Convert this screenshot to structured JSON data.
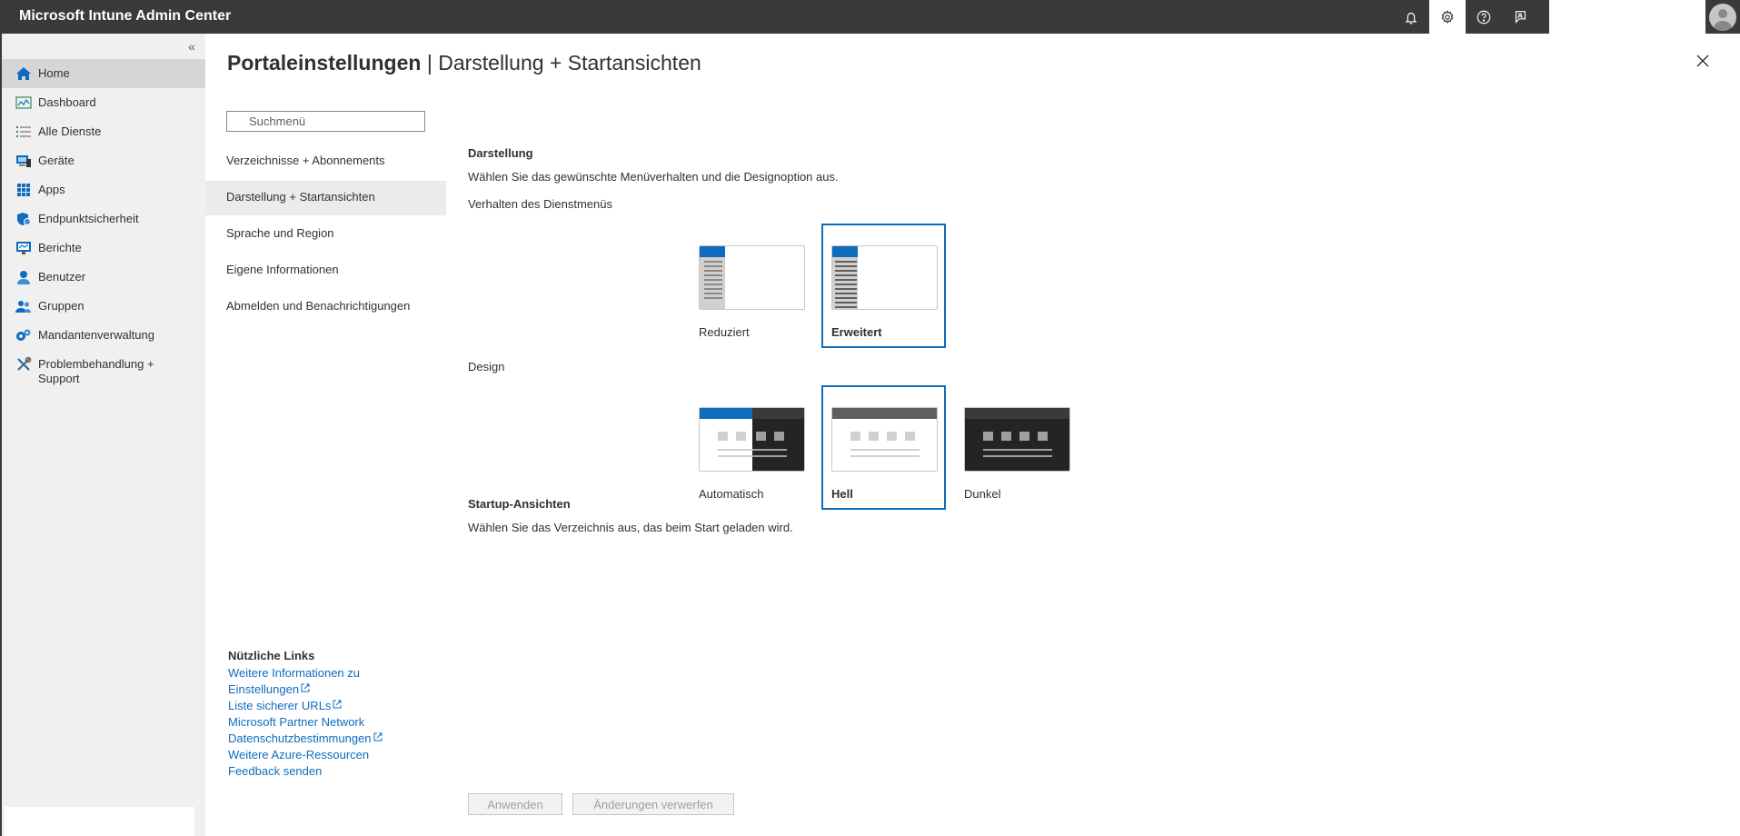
{
  "app": {
    "title": "Microsoft Intune Admin Center"
  },
  "topbar": {
    "icons": [
      "bell-icon",
      "gear-icon",
      "help-icon",
      "feedback-icon"
    ],
    "active_icon": "gear-icon"
  },
  "leftnav": {
    "collapse_glyph": "«",
    "items": [
      {
        "label": "Home",
        "icon": "home-icon",
        "selected": true
      },
      {
        "label": "Dashboard",
        "icon": "dashboard-icon"
      },
      {
        "label": "Alle Dienste",
        "icon": "list-icon"
      },
      {
        "label": "Geräte",
        "icon": "devices-icon"
      },
      {
        "label": "Apps",
        "icon": "apps-grid-icon"
      },
      {
        "label": "Endpunktsicherheit",
        "icon": "shield-icon"
      },
      {
        "label": "Berichte",
        "icon": "reports-icon"
      },
      {
        "label": "Benutzer",
        "icon": "user-icon"
      },
      {
        "label": "Gruppen",
        "icon": "groups-icon"
      },
      {
        "label": "Mandantenverwaltung",
        "icon": "tenant-admin-icon"
      },
      {
        "label": "Problembehandlung + Support",
        "icon": "troubleshoot-icon"
      }
    ]
  },
  "page": {
    "title_bold": "Portaleinstellungen",
    "title_separator": " | ",
    "title_rest": "Darstellung + Startansichten"
  },
  "settings_menu": {
    "search_placeholder": "Suchmenü",
    "items": [
      {
        "label": "Verzeichnisse + Abonnements"
      },
      {
        "label": "Darstellung + Startansichten",
        "selected": true
      },
      {
        "label": "Sprache und Region"
      },
      {
        "label": "Eigene Informationen"
      },
      {
        "label": "Abmelden und Benachrichtigungen"
      }
    ]
  },
  "useful_links": {
    "title": "Nützliche Links",
    "items": [
      {
        "label": "Weitere Informationen zu",
        "label2": "Einstellungen",
        "external": true
      },
      {
        "label": "Liste sicherer URLs",
        "external": true
      },
      {
        "label": "Microsoft Partner Network"
      },
      {
        "label": "Datenschutzbestimmungen",
        "external": true
      },
      {
        "label": "Weitere Azure-Ressourcen"
      },
      {
        "label": "Feedback senden"
      }
    ]
  },
  "appearance": {
    "title": "Darstellung",
    "description": "Wählen Sie das gewünschte Menüverhalten und die Designoption aus.",
    "menu_behavior": {
      "label": "Verhalten des Dienstmenüs",
      "options": [
        {
          "label": "Reduziert",
          "selected": false
        },
        {
          "label": "Erweitert",
          "selected": true
        }
      ]
    },
    "design": {
      "label": "Design",
      "options": [
        {
          "label": "Automatisch",
          "selected": false
        },
        {
          "label": "Hell",
          "selected": true
        },
        {
          "label": "Dunkel",
          "selected": false
        }
      ]
    }
  },
  "startup": {
    "title": "Startup-Ansichten",
    "description": "Wählen Sie das Verzeichnis aus, das beim Start geladen wird."
  },
  "footer": {
    "apply_label": "Anwenden",
    "discard_label": "Änderungen verwerfen"
  },
  "colors": {
    "topbar": "#3b3a39",
    "accent": "#0f6cbd",
    "nav_bg": "#f0f0f0",
    "nav_selected": "#d6d6d6"
  }
}
